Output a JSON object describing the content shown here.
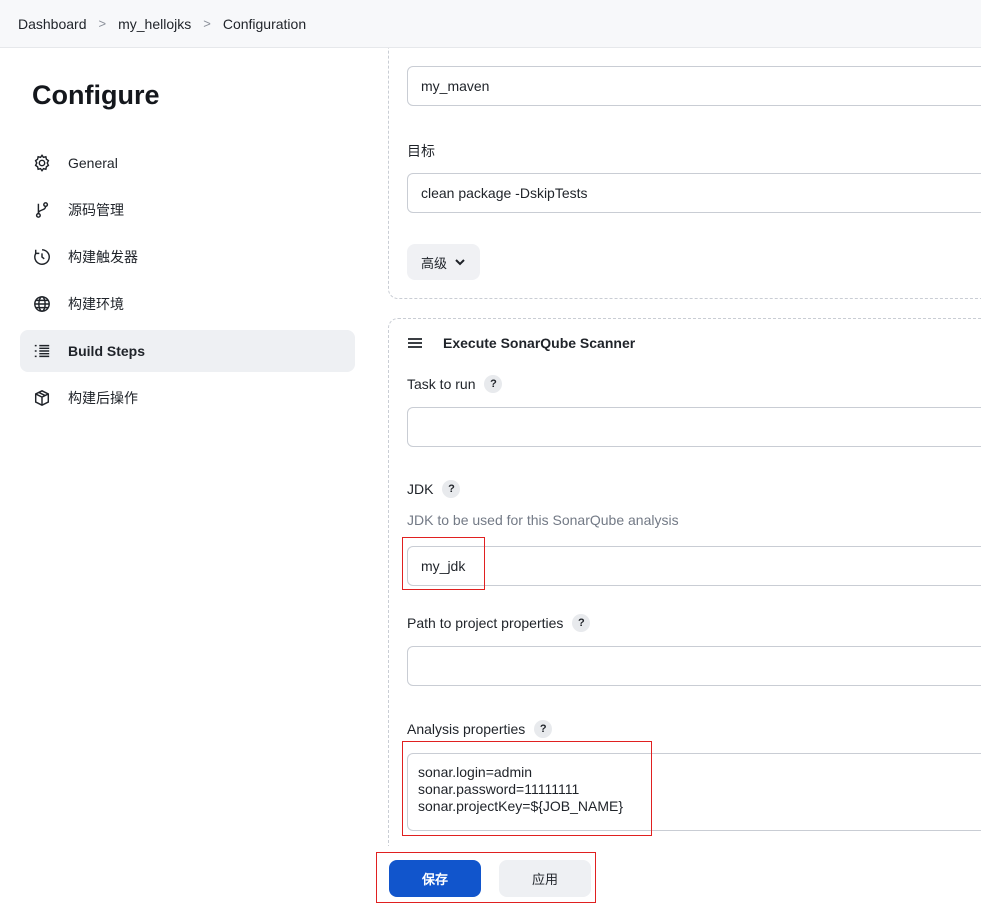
{
  "breadcrumb": [
    "Dashboard",
    "my_hellojks",
    "Configuration"
  ],
  "page_title": "Configure",
  "nav": [
    {
      "label": "General",
      "icon": "gear-icon",
      "active": false
    },
    {
      "label": "源码管理",
      "icon": "branch-icon",
      "active": false
    },
    {
      "label": "构建触发器",
      "icon": "timer-icon",
      "active": false
    },
    {
      "label": "构建环境",
      "icon": "globe-icon",
      "active": false
    },
    {
      "label": "Build Steps",
      "icon": "list-icon",
      "active": true
    },
    {
      "label": "构建后操作",
      "icon": "package-icon",
      "active": false
    }
  ],
  "maven_step": {
    "maven_version_value": "my_maven",
    "goals_label": "目标",
    "goals_value": "clean package -DskipTests",
    "advanced_label": "高级"
  },
  "sonar_step": {
    "title": "Execute SonarQube Scanner",
    "task_label": "Task to run",
    "task_value": "",
    "jdk_label": "JDK",
    "jdk_desc": "JDK to be used for this SonarQube analysis",
    "jdk_value": "my_jdk",
    "path_label": "Path to project properties",
    "path_value": "",
    "analysis_label": "Analysis properties",
    "analysis_lines": [
      "sonar.login=admin",
      "sonar.password=11111111",
      "sonar.projectKey=${JOB_NAME}"
    ]
  },
  "actions": {
    "save": "保存",
    "apply": "应用"
  },
  "colors": {
    "primary": "#1155cc",
    "highlight": "#e02020"
  }
}
